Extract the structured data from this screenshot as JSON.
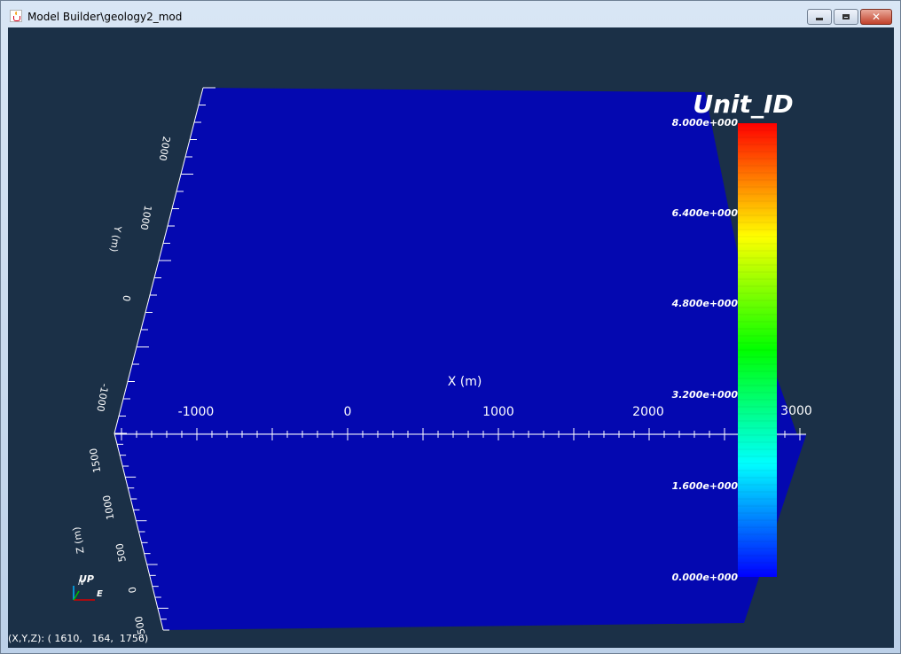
{
  "window": {
    "title": "Model Builder\\geology2_mod",
    "minimize_label": "minimize",
    "maximize_label": "maximize",
    "close_label": "close"
  },
  "scene": {
    "background": "#1b3047",
    "model_color": "#0408b0",
    "axis_color": "#ffffff",
    "x_axis": {
      "title": "X (m)",
      "ticks": [
        "-1000",
        "0",
        "1000",
        "2000",
        "3000"
      ]
    },
    "y_axis": {
      "title": "Y (m)",
      "ticks": [
        "-1000",
        "0",
        "1000",
        "2000"
      ]
    },
    "z_axis": {
      "title": "Z (m)",
      "ticks": [
        "1500",
        "1000",
        "500",
        "0",
        "-500"
      ]
    },
    "orientation": {
      "up_label": "UP",
      "north_label": "N",
      "east_label": "E"
    }
  },
  "legend": {
    "title": "Unit_ID",
    "labels": [
      "8.000e+000",
      "6.400e+000",
      "4.800e+000",
      "3.200e+000",
      "1.600e+000",
      "0.000e+000"
    ],
    "colors": [
      "#ff0000",
      "#ffff00",
      "#00ff00",
      "#00ffff",
      "#0000ff"
    ]
  },
  "status": {
    "text": "(X,Y,Z): ( 1610,   164,  1756)"
  }
}
